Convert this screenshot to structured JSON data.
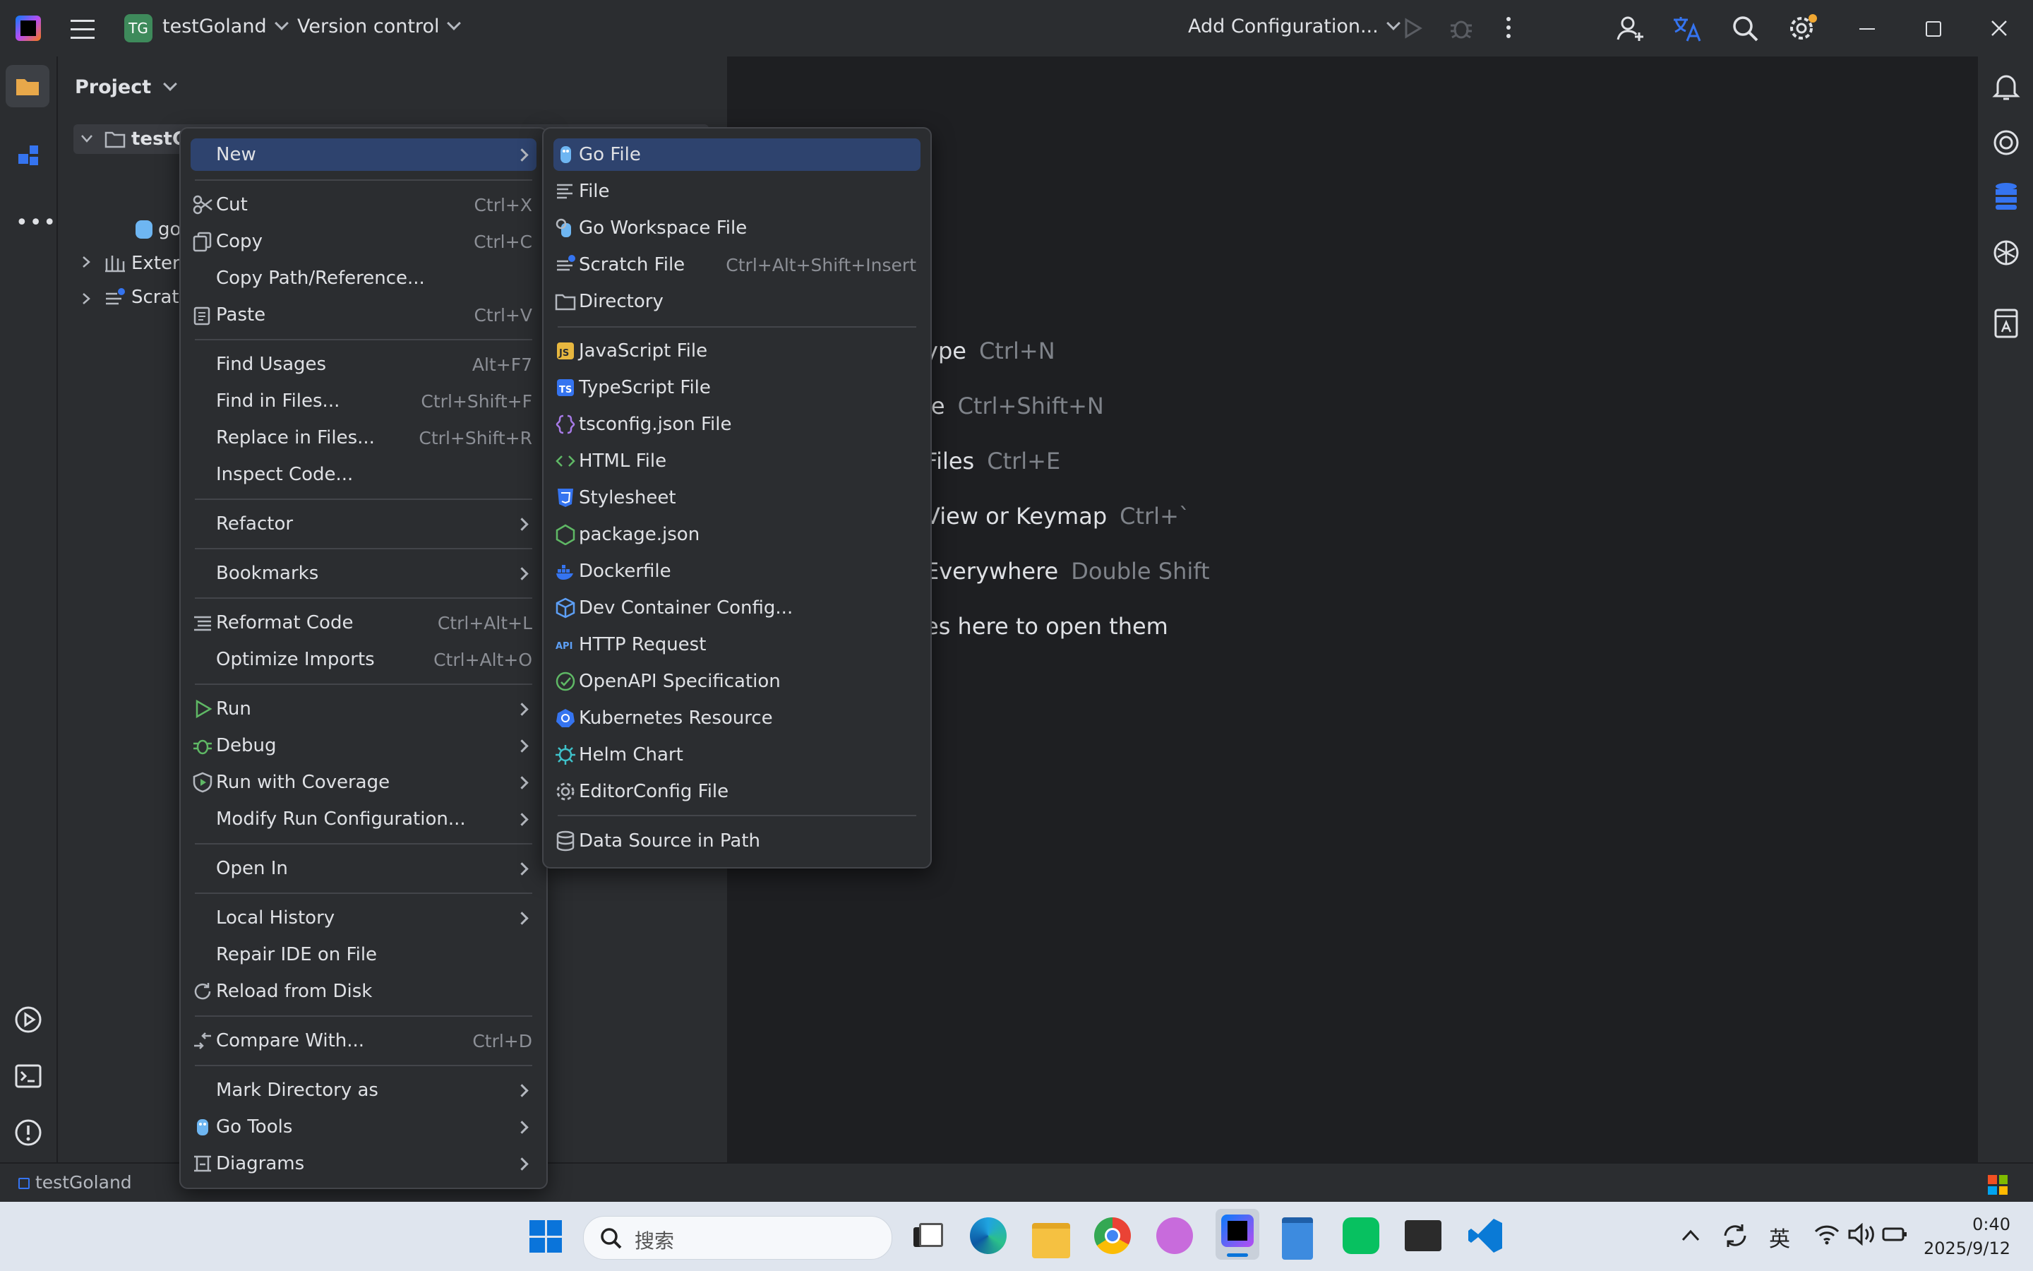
{
  "titlebar": {
    "project_badge": "TG",
    "project_name": "testGoland",
    "vcs": "Version control",
    "run_config": "Add Configuration..."
  },
  "project_panel": {
    "title": "Project",
    "tree": [
      "testG",
      "go",
      "Extern",
      "Scratc"
    ]
  },
  "context_menu": {
    "items": [
      {
        "label": "New",
        "shortcut": "",
        "submenu": true
      },
      {
        "label": "Cut",
        "shortcut": "Ctrl+X"
      },
      {
        "label": "Copy",
        "shortcut": "Ctrl+C"
      },
      {
        "label": "Copy Path/Reference...",
        "shortcut": ""
      },
      {
        "label": "Paste",
        "shortcut": "Ctrl+V"
      },
      {
        "label": "Find Usages",
        "shortcut": "Alt+F7"
      },
      {
        "label": "Find in Files...",
        "shortcut": "Ctrl+Shift+F"
      },
      {
        "label": "Replace in Files...",
        "shortcut": "Ctrl+Shift+R"
      },
      {
        "label": "Inspect Code...",
        "shortcut": ""
      },
      {
        "label": "Refactor",
        "shortcut": ""
      },
      {
        "label": "Bookmarks",
        "shortcut": ""
      },
      {
        "label": "Reformat Code",
        "shortcut": "Ctrl+Alt+L"
      },
      {
        "label": "Optimize Imports",
        "shortcut": "Ctrl+Alt+O"
      },
      {
        "label": "Run",
        "shortcut": ""
      },
      {
        "label": "Debug",
        "shortcut": ""
      },
      {
        "label": "Run with Coverage",
        "shortcut": ""
      },
      {
        "label": "Modify Run Configuration...",
        "shortcut": ""
      },
      {
        "label": "Open In",
        "shortcut": ""
      },
      {
        "label": "Local History",
        "shortcut": ""
      },
      {
        "label": "Repair IDE on File",
        "shortcut": ""
      },
      {
        "label": "Reload from Disk",
        "shortcut": ""
      },
      {
        "label": "Compare With...",
        "shortcut": "Ctrl+D"
      },
      {
        "label": "Mark Directory as",
        "shortcut": ""
      },
      {
        "label": "Go Tools",
        "shortcut": ""
      },
      {
        "label": "Diagrams",
        "shortcut": ""
      }
    ]
  },
  "new_submenu": {
    "items": [
      {
        "label": "Go File",
        "shortcut": ""
      },
      {
        "label": "File",
        "shortcut": ""
      },
      {
        "label": "Go Workspace File",
        "shortcut": ""
      },
      {
        "label": "Scratch File",
        "shortcut": "Ctrl+Alt+Shift+Insert"
      },
      {
        "label": "Directory",
        "shortcut": ""
      },
      {
        "label": "JavaScript File",
        "shortcut": ""
      },
      {
        "label": "TypeScript File",
        "shortcut": ""
      },
      {
        "label": "tsconfig.json File",
        "shortcut": ""
      },
      {
        "label": "HTML File",
        "shortcut": ""
      },
      {
        "label": "Stylesheet",
        "shortcut": ""
      },
      {
        "label": "package.json",
        "shortcut": ""
      },
      {
        "label": "Dockerfile",
        "shortcut": ""
      },
      {
        "label": "Dev Container Config...",
        "shortcut": ""
      },
      {
        "label": "HTTP Request",
        "shortcut": ""
      },
      {
        "label": "OpenAPI Specification",
        "shortcut": ""
      },
      {
        "label": "Kubernetes Resource",
        "shortcut": ""
      },
      {
        "label": "Helm Chart",
        "shortcut": ""
      },
      {
        "label": "EditorConfig File",
        "shortcut": ""
      },
      {
        "label": "Data Source in Path",
        "shortcut": ""
      }
    ]
  },
  "editor_hints": [
    {
      "text": "ype",
      "key": "Ctrl+N"
    },
    {
      "text": "le",
      "key": "Ctrl+Shift+N"
    },
    {
      "text": "Files",
      "key": "Ctrl+E"
    },
    {
      "text": "View or Keymap",
      "key": "Ctrl+`"
    },
    {
      "text": "Everywhere",
      "key": "Double Shift"
    },
    {
      "text": "es here to open them",
      "key": ""
    }
  ],
  "statusbar": {
    "project": "testGoland"
  },
  "taskbar": {
    "search_placeholder": "搜索",
    "ime": "英",
    "time": "0:40",
    "date": "2025/9/12"
  },
  "colors": {
    "selection": "#2e436e",
    "accent": "#3574f0",
    "background": "#1e1f22",
    "panel": "#2b2d30"
  }
}
